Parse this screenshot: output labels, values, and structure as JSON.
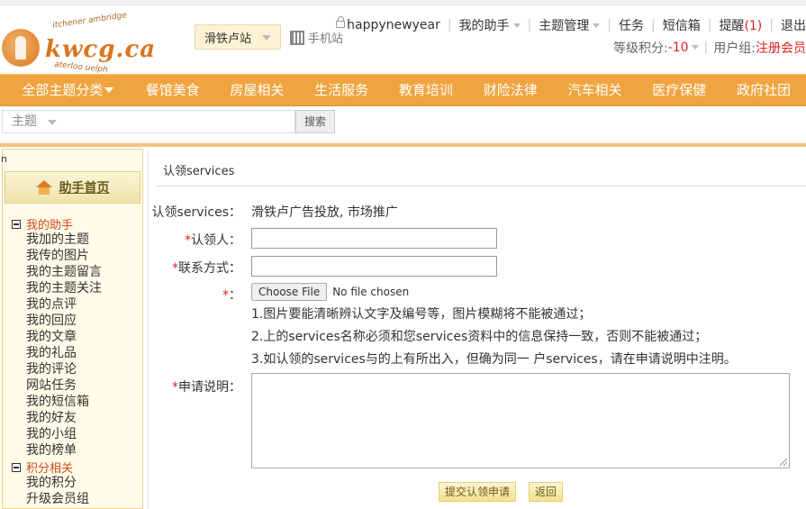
{
  "header": {
    "logo": {
      "brand": "kwcg.ca",
      "arc_top": "itchener ambridge",
      "arc_bottom": "aterloo uelph"
    },
    "station": "滑铁卢站",
    "mobile": "手机站",
    "user": {
      "username": "happynewyear",
      "assistant": "我的助手",
      "topic_manage": "主题管理",
      "tasks": "任务",
      "sms": "短信箱",
      "remind": "提醒",
      "remind_count": "(1)",
      "logout": "退出"
    },
    "score": {
      "label": "等级积分:",
      "value": "-10",
      "group_label": "用户组:",
      "group_value": "注册会员"
    }
  },
  "nav": {
    "all": "全部主题分类",
    "items": [
      "餐馆美食",
      "房屋相关",
      "生活服务",
      "教育培训",
      "财险法律",
      "汽车相关",
      "医疗保健",
      "政府社团"
    ]
  },
  "search": {
    "select": "主题",
    "button": "搜索"
  },
  "sidebar": {
    "stub": "n",
    "home": "助手首页",
    "group1": "我的助手",
    "group1_items": [
      "我加的主题",
      "我传的图片",
      "我的主题留言",
      "我的主题关注",
      "我的点评",
      "我的回应",
      "我的文章",
      "我的礼品",
      "我的评论",
      "网站任务",
      "我的短信箱",
      "我的好友",
      "我的小组",
      "我的榜单"
    ],
    "group2": "积分相关",
    "group2_items": [
      "我的积分",
      "升级会员组"
    ]
  },
  "main": {
    "title": "认领services",
    "form": {
      "service_label": "认领services：",
      "service_value": "滑铁卢广告投放, 市场推广",
      "claimer_label": "认领人：",
      "contact_label": "联系方式：",
      "file_label": "：",
      "file_button": "Choose File",
      "file_status": "No file chosen",
      "notes": [
        "1.图片要能清晰辨认文字及编号等，图片模糊将不能被通过；",
        "2.上的services名称必须和您services资料中的信息保持一致，否则不能被通过；",
        "3.如认领的services与的上有所出入，但确为同一 户services，请在申请说明中注明。"
      ],
      "desc_label": "申请说明：",
      "required_mark": "*"
    },
    "buttons": {
      "submit": "提交认领申请",
      "back": "返回"
    }
  }
}
